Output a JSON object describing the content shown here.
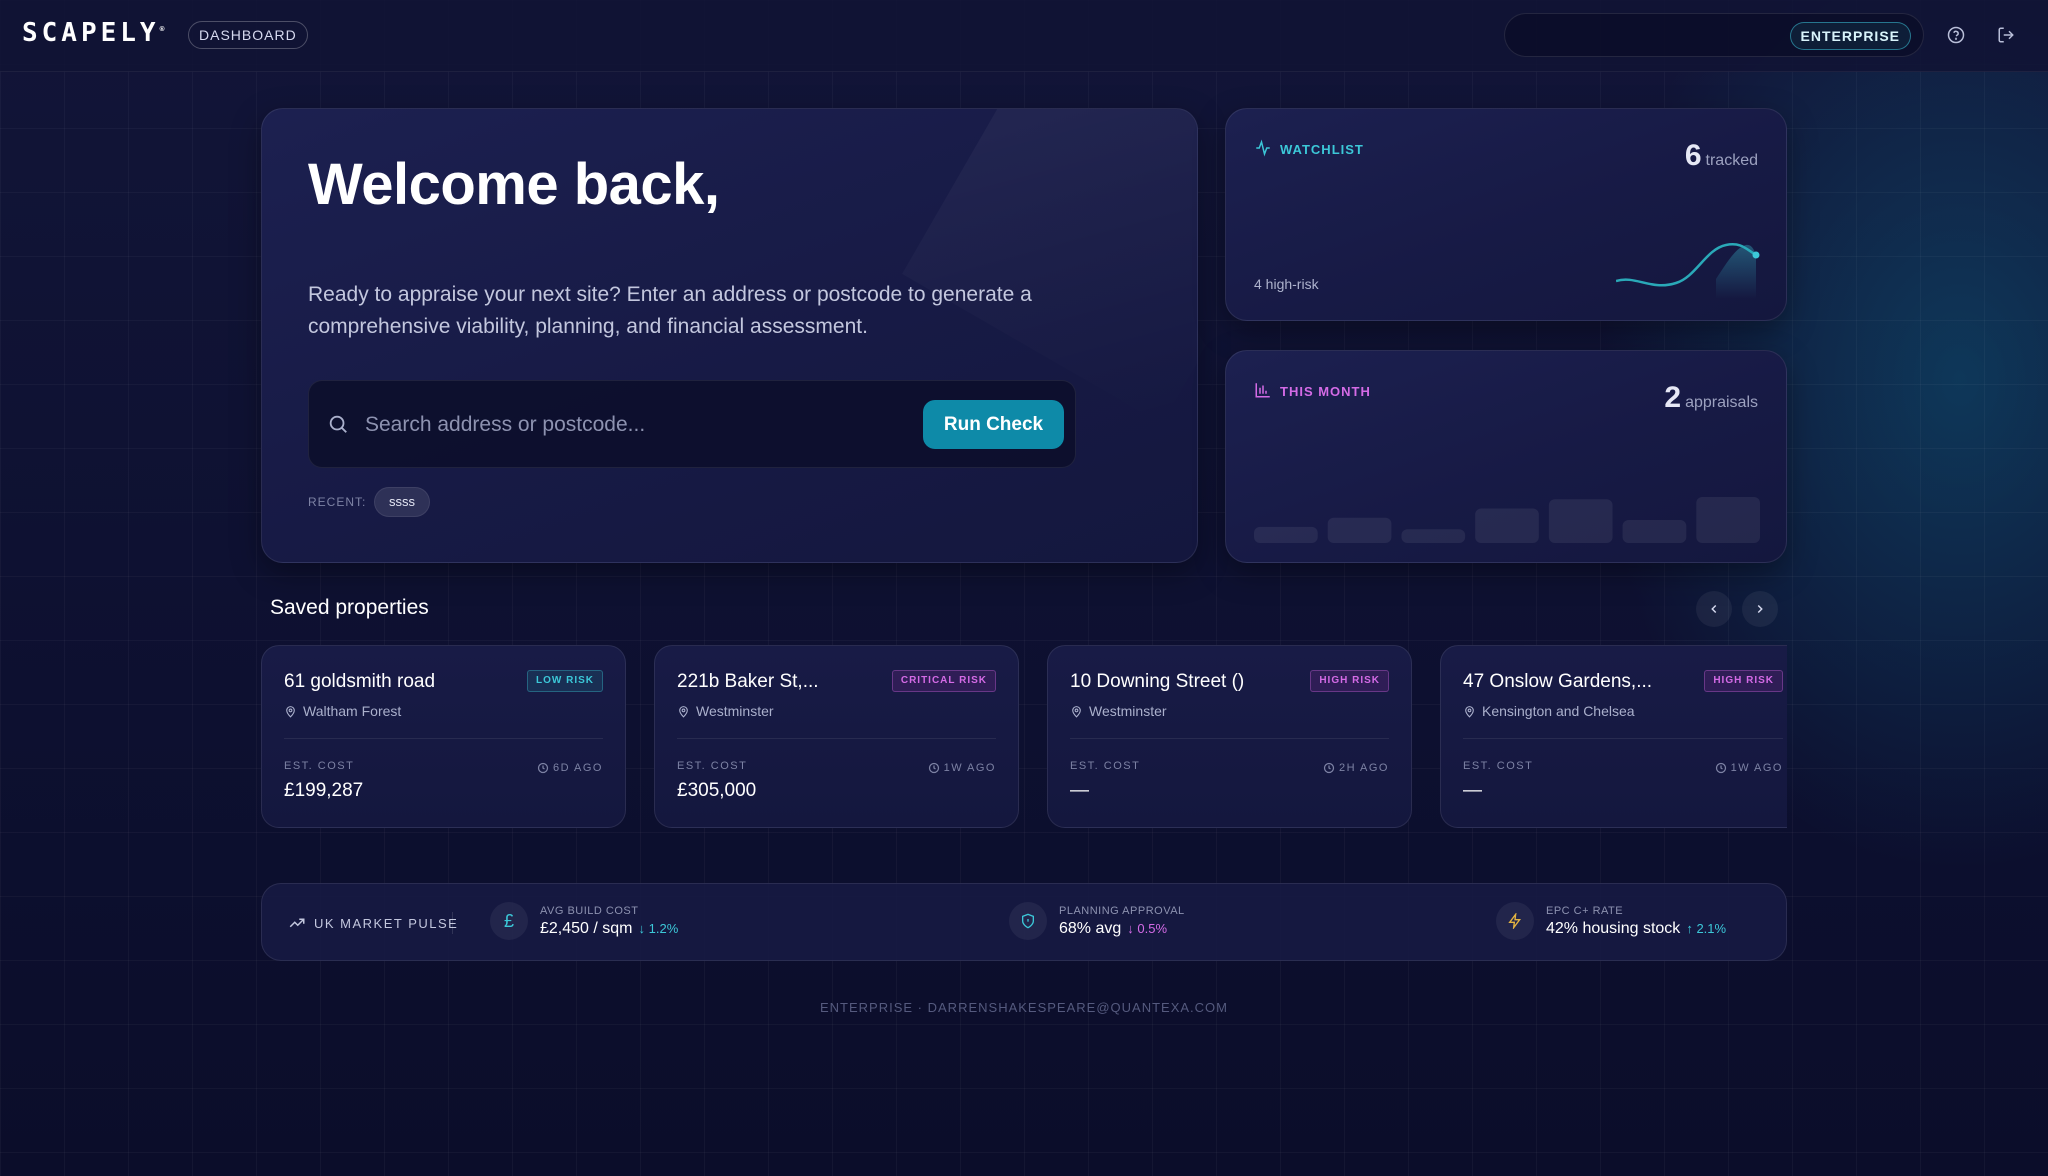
{
  "header": {
    "logo": "SCAPELY",
    "logo_mark": "®",
    "breadcrumb": "DASHBOARD",
    "plan_badge": "ENTERPRISE"
  },
  "hero": {
    "title": "Welcome back,",
    "description": "Ready to appraise your next site? Enter an address or postcode to generate a comprehensive viability, planning, and financial assessment.",
    "search_placeholder": "Search address or postcode...",
    "search_value": "",
    "run_button": "Run Check",
    "recent_label": "RECENT:",
    "recent_items": [
      "ssss"
    ]
  },
  "watchlist": {
    "label": "WATCHLIST",
    "count": "6",
    "unit": "tracked",
    "sub": "4 high-risk"
  },
  "this_month": {
    "label": "THIS MONTH",
    "count": "2",
    "unit": "appraisals",
    "bar_levels": [
      0.35,
      0.55,
      0.3,
      0.75,
      0.95,
      0.5,
      1.0
    ]
  },
  "saved": {
    "title": "Saved properties",
    "cost_label": "EST. COST",
    "items": [
      {
        "name": "61 goldsmith road",
        "area": "Waltham Forest",
        "risk": "LOW RISK",
        "risk_level": "low",
        "cost": "£199,287",
        "ago": "6D AGO"
      },
      {
        "name": "221b Baker St,...",
        "area": "Westminster",
        "risk": "CRITICAL RISK",
        "risk_level": "critical",
        "cost": "£305,000",
        "ago": "1W AGO"
      },
      {
        "name": "10 Downing Street ()",
        "area": "Westminster",
        "risk": "HIGH RISK",
        "risk_level": "high",
        "cost": "—",
        "ago": "2H AGO"
      },
      {
        "name": "47 Onslow Gardens,...",
        "area": "Kensington and Chelsea",
        "risk": "HIGH RISK",
        "risk_level": "high",
        "cost": "—",
        "ago": "1W AGO"
      }
    ]
  },
  "pulse": {
    "title": "UK MARKET PULSE",
    "metrics": [
      {
        "label": "AVG BUILD COST",
        "value": "£2,450 / sqm",
        "delta": "1.2%",
        "direction": "down",
        "icon": "pound-icon"
      },
      {
        "label": "PLANNING APPROVAL",
        "value": "68% avg",
        "delta": "0.5%",
        "direction": "down",
        "icon": "shield-icon"
      },
      {
        "label": "EPC C+ RATE",
        "value": "42% housing stock",
        "delta": "2.1%",
        "direction": "up",
        "icon": "lightning-icon"
      }
    ]
  },
  "footer": {
    "text": "ENTERPRISE · DARRENSHAKESPEARE@QUANTEXA.COM"
  },
  "colors": {
    "accent_teal": "#3cc8d8",
    "accent_pink": "#d46be6",
    "button": "#0e8aa8",
    "background": "#0d1030"
  }
}
